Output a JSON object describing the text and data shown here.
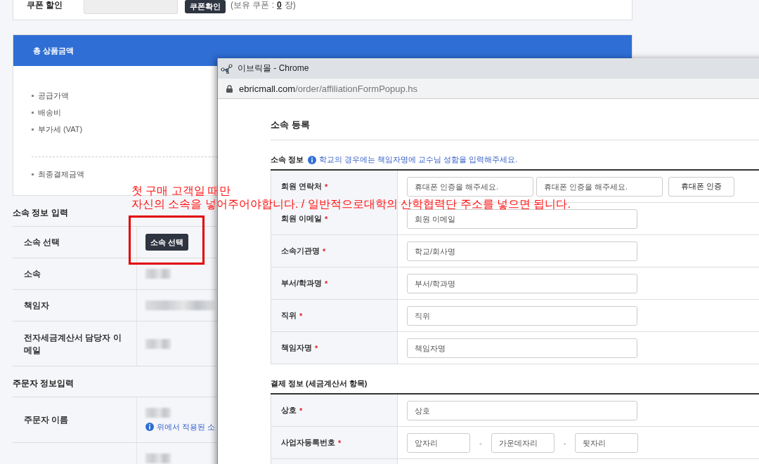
{
  "coupon": {
    "label": "쿠폰 할인",
    "button": "쿠폰확인",
    "owned_label": "(보유 쿠폰 :",
    "owned_count": "0",
    "owned_unit": "장)"
  },
  "summary": {
    "title": "총 상품금액",
    "items": [
      "공급가액",
      "배송비",
      "부가세 (VAT)"
    ],
    "total_label": "최종결제금액"
  },
  "affiliation": {
    "heading": "소속 정보 입력",
    "rows": [
      {
        "label": "소속 선택",
        "kind": "button",
        "button": "소속 선택"
      },
      {
        "label": "소속",
        "kind": "redacted"
      },
      {
        "label": "책임자",
        "kind": "redacted"
      },
      {
        "label": "전자세금계산서 담당자 이메일",
        "kind": "redacted"
      }
    ]
  },
  "orderer": {
    "heading": "주문자 정보입력",
    "rows": [
      {
        "label": "주문자 이름",
        "kind": "redacted",
        "note": "위에서 적용된 소"
      },
      {
        "kind": "redacted"
      }
    ]
  },
  "popup": {
    "title": "이브릭몰 - Chrome",
    "url_host": "ebricmall.com",
    "url_path": "/order/affiliationFormPopup.hs",
    "heading": "소속 등록",
    "sections": [
      {
        "title": "소속 정보",
        "note": "학교의 경우에는 책임자명에 교수님 성함을 입력해주세요.",
        "rows": [
          {
            "label": "회원 연락처",
            "required": true,
            "required_mark": "*",
            "kind": "phone",
            "placeholders": [
              "휴대폰 인증을 해주세요.",
              "휴대폰 인증을 해주세요."
            ],
            "button": "휴대폰 인증"
          },
          {
            "label": "회원 이메일",
            "required": true,
            "required_mark": "*",
            "kind": "text",
            "placeholders": [
              "회원 이메일"
            ]
          },
          {
            "label": "소속기관명",
            "required": true,
            "required_mark": "*",
            "kind": "text",
            "placeholders": [
              "학교/회사명"
            ]
          },
          {
            "label": "부서/학과명",
            "required": true,
            "required_mark": "*",
            "kind": "text",
            "placeholders": [
              "부서/학과명"
            ]
          },
          {
            "label": "직위",
            "required": true,
            "required_mark": "*",
            "kind": "text",
            "placeholders": [
              "직위"
            ]
          },
          {
            "label": "책임자명",
            "required": true,
            "required_mark": "*",
            "kind": "text",
            "placeholders": [
              "책임자명"
            ]
          }
        ]
      },
      {
        "title": "결제 정보 (세금계산서 항목)",
        "rows": [
          {
            "label": "상호",
            "required": true,
            "required_mark": "*",
            "kind": "text",
            "placeholders": [
              "상호"
            ]
          },
          {
            "label": "사업자등록번호",
            "required": true,
            "required_mark": "*",
            "kind": "split",
            "placeholders": [
              "앞자리",
              "가운데자리",
              "뒷자리"
            ],
            "separators": [
              "-",
              "-"
            ]
          },
          {
            "kind": "empty"
          }
        ]
      }
    ]
  },
  "annotation": {
    "lines": [
      "첫 구매 고객일 때만",
      "자신의 소속을 넣어주어야합니다. / 일반적으로대학의 산학협력단 주소를 넣으면 됩니다."
    ]
  }
}
